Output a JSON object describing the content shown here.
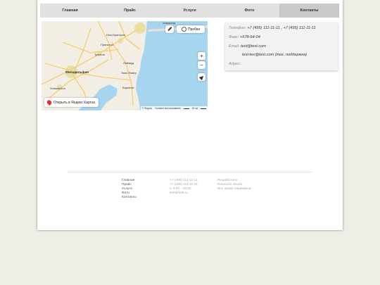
{
  "nav": {
    "items": [
      {
        "label": "Главная"
      },
      {
        "label": "Прайс"
      },
      {
        "label": "Услуги"
      },
      {
        "label": "Фото"
      },
      {
        "label": "Контакты"
      }
    ],
    "active_index": 4
  },
  "map": {
    "traffic_label": "Пробки",
    "open_label": "Открыть в Яндекс Картах",
    "zoom_in": "+",
    "zoom_out": "−",
    "cities": {
      "new_york": "Нью-Йорк",
      "new_brunswick": "Нью-Брансуик",
      "princeton": "Принстон",
      "trenton": "Трентон",
      "philadelphia": "Филадельфия",
      "lakewood": "Лейквуд",
      "toms_river": "Томс-Ривер",
      "barnegat": "Барнегат",
      "wilmington": "Уилмингтон",
      "hempstead": "Хемпстед"
    },
    "copyright": "© Яндекс",
    "terms": "Условия использования",
    "scale": "40 км",
    "colors": {
      "land": "#f2eee4",
      "water": "#a7d4ee",
      "road": "#f7c75b"
    }
  },
  "contacts": {
    "phone_label": "Телефон:",
    "phone_value": "+7 (495) 111-11-11 , +7 (495) 111-11-11",
    "fax_label": "Факс:",
    "fax_value": "+678-54-04",
    "email_label": "Email:",
    "email_value": "test@test.com",
    "email_support": "test-tex@test.com (тех. поддержка)",
    "address_label": "Адрес:"
  },
  "footer": {
    "links": [
      "Главная",
      "Прайс",
      "Услуги",
      "Фото",
      "Контакты"
    ],
    "contact": [
      "+7 (495) 111-11-11",
      "+7 (495) 111-11-11",
      "С 9:00 - 18:00",
      "test@test.ru"
    ],
    "credits": [
      "Разработано",
      "Resource Studio",
      "Все права защищены"
    ]
  }
}
